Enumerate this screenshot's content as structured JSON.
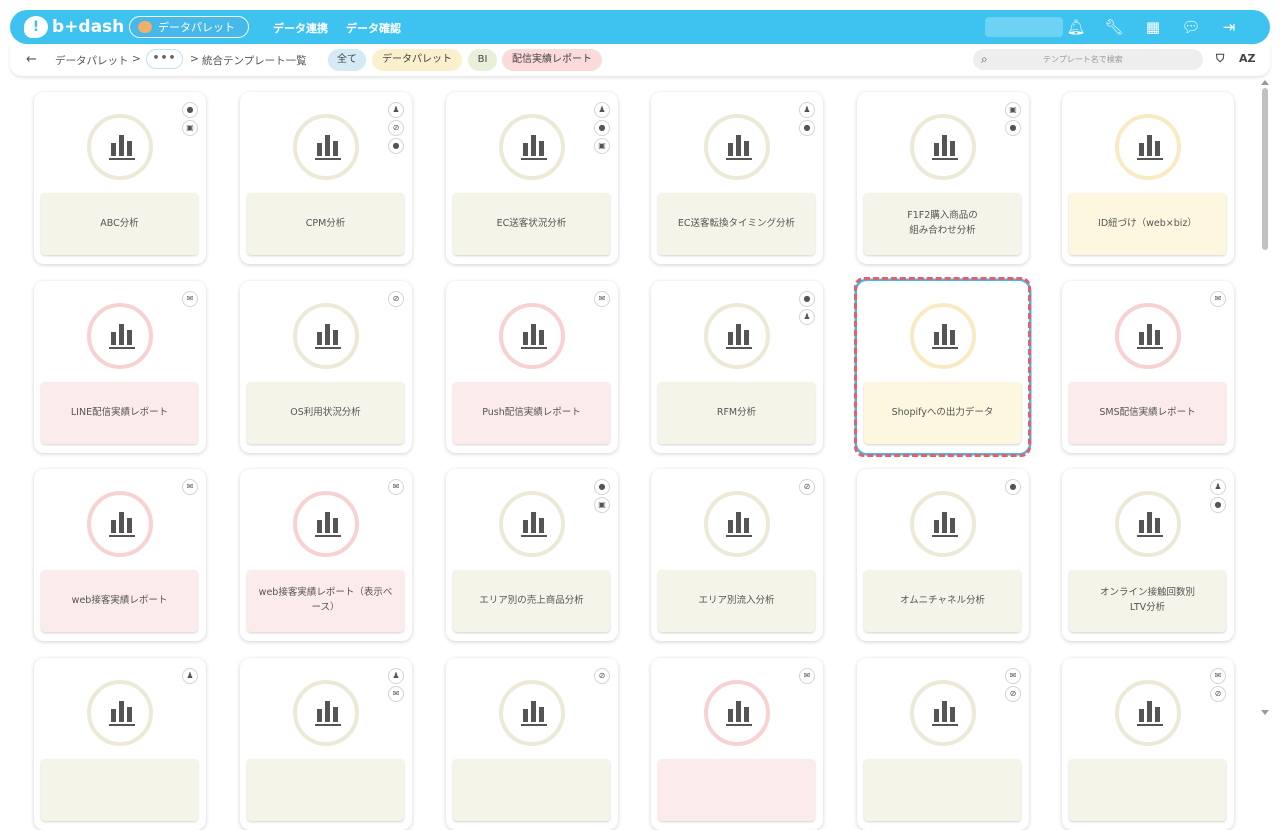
{
  "header": {
    "logo_text": "b+dash",
    "app_name": "データパレット",
    "nav_links": [
      "データ連携",
      "データ確認"
    ]
  },
  "subbar": {
    "back": "←",
    "breadcrumb_root": "データパレット",
    "sep1": ">",
    "more": "•••",
    "sep2": ">",
    "current": "統合テンプレート一覧",
    "filters": [
      {
        "label": "全て",
        "bg": "#d4eaf4"
      },
      {
        "label": "データパレット",
        "bg": "#fbf0cd"
      },
      {
        "label": "BI",
        "bg": "#e9f0da"
      },
      {
        "label": "配信実績レポート",
        "bg": "#fbdada"
      }
    ],
    "search_placeholder": "テンプレート名で検索",
    "sort_label": "AZ"
  },
  "colors": {
    "brand": "#3ec3f0",
    "card_green_bg": "#f4f4e8",
    "card_yellow_bg": "#fdf7e0",
    "card_pink_bg": "#fcebeb",
    "selected_border": "#46b8ea",
    "highlight_dash": "#e5606b"
  },
  "cards": [
    {
      "title": "ABC分析",
      "tone": "green",
      "badges": [
        "coin-icon",
        "gift-icon"
      ]
    },
    {
      "title": "CPM分析",
      "tone": "green",
      "badges": [
        "people-icon",
        "no-coin-icon",
        "coin-icon"
      ]
    },
    {
      "title": "EC送客状況分析",
      "tone": "green",
      "badges": [
        "people-icon",
        "coin-icon",
        "gift-icon"
      ]
    },
    {
      "title": "EC送客転換タイミング分析",
      "tone": "green",
      "badges": [
        "people-icon",
        "coin-icon"
      ]
    },
    {
      "title": "F1F2購入商品の\n組み合わせ分析",
      "tone": "green",
      "badges": [
        "gift-icon",
        "coin-icon"
      ]
    },
    {
      "title": "ID紐づけ（web×biz）",
      "tone": "yellow",
      "badges": []
    },
    {
      "title": "LINE配信実績レポート",
      "tone": "pink",
      "badges": [
        "mail-icon"
      ]
    },
    {
      "title": "OS利用状況分析",
      "tone": "green",
      "badges": [
        "no-coin-icon"
      ]
    },
    {
      "title": "Push配信実績レポート",
      "tone": "pink",
      "badges": [
        "mail-icon"
      ]
    },
    {
      "title": "RFM分析",
      "tone": "green",
      "badges": [
        "coin-icon",
        "people-icon"
      ]
    },
    {
      "title": "Shopifyへの出力データ",
      "tone": "yellow",
      "badges": [],
      "selected": true
    },
    {
      "title": "SMS配信実績レポート",
      "tone": "pink",
      "badges": [
        "mail-icon"
      ]
    },
    {
      "title": "web接客実績レポート",
      "tone": "pink",
      "badges": [
        "mail-icon"
      ]
    },
    {
      "title": "web接客実績レポート（表示ベース）",
      "tone": "pink",
      "badges": [
        "mail-icon"
      ]
    },
    {
      "title": "エリア別の売上商品分析",
      "tone": "green",
      "badges": [
        "coin-icon",
        "gift-icon"
      ]
    },
    {
      "title": "エリア別流入分析",
      "tone": "green",
      "badges": [
        "no-coin-icon"
      ]
    },
    {
      "title": "オムニチャネル分析",
      "tone": "green",
      "badges": [
        "coin-icon"
      ]
    },
    {
      "title": "オンライン接触回数別\nLTV分析",
      "tone": "green",
      "badges": [
        "people-icon",
        "coin-icon"
      ]
    },
    {
      "title": "",
      "tone": "green",
      "badges": [
        "people-icon"
      ]
    },
    {
      "title": "",
      "tone": "green",
      "badges": [
        "people-icon",
        "mail-icon"
      ]
    },
    {
      "title": "",
      "tone": "green",
      "badges": [
        "no-coin-icon"
      ]
    },
    {
      "title": "",
      "tone": "pink",
      "badges": [
        "mail-icon"
      ]
    },
    {
      "title": "",
      "tone": "green",
      "badges": [
        "mail-icon",
        "no-coin-icon"
      ]
    },
    {
      "title": "",
      "tone": "green",
      "badges": [
        "mail-icon",
        "no-coin-icon"
      ]
    }
  ]
}
